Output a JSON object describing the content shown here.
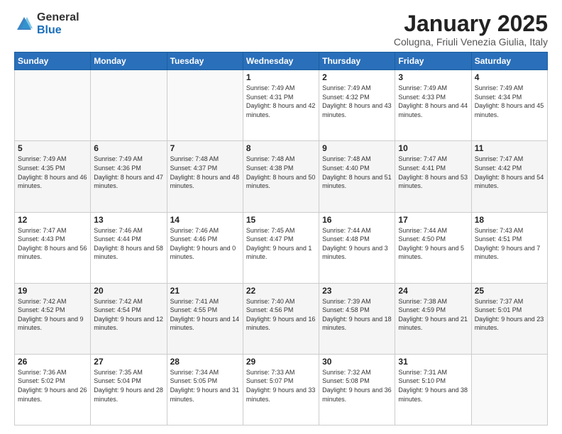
{
  "logo": {
    "general": "General",
    "blue": "Blue"
  },
  "title": {
    "month_year": "January 2025",
    "location": "Colugna, Friuli Venezia Giulia, Italy"
  },
  "weekdays": [
    "Sunday",
    "Monday",
    "Tuesday",
    "Wednesday",
    "Thursday",
    "Friday",
    "Saturday"
  ],
  "weeks": [
    [
      {
        "day": "",
        "info": ""
      },
      {
        "day": "",
        "info": ""
      },
      {
        "day": "",
        "info": ""
      },
      {
        "day": "1",
        "info": "Sunrise: 7:49 AM\nSunset: 4:31 PM\nDaylight: 8 hours and 42 minutes."
      },
      {
        "day": "2",
        "info": "Sunrise: 7:49 AM\nSunset: 4:32 PM\nDaylight: 8 hours and 43 minutes."
      },
      {
        "day": "3",
        "info": "Sunrise: 7:49 AM\nSunset: 4:33 PM\nDaylight: 8 hours and 44 minutes."
      },
      {
        "day": "4",
        "info": "Sunrise: 7:49 AM\nSunset: 4:34 PM\nDaylight: 8 hours and 45 minutes."
      }
    ],
    [
      {
        "day": "5",
        "info": "Sunrise: 7:49 AM\nSunset: 4:35 PM\nDaylight: 8 hours and 46 minutes."
      },
      {
        "day": "6",
        "info": "Sunrise: 7:49 AM\nSunset: 4:36 PM\nDaylight: 8 hours and 47 minutes."
      },
      {
        "day": "7",
        "info": "Sunrise: 7:48 AM\nSunset: 4:37 PM\nDaylight: 8 hours and 48 minutes."
      },
      {
        "day": "8",
        "info": "Sunrise: 7:48 AM\nSunset: 4:38 PM\nDaylight: 8 hours and 50 minutes."
      },
      {
        "day": "9",
        "info": "Sunrise: 7:48 AM\nSunset: 4:40 PM\nDaylight: 8 hours and 51 minutes."
      },
      {
        "day": "10",
        "info": "Sunrise: 7:47 AM\nSunset: 4:41 PM\nDaylight: 8 hours and 53 minutes."
      },
      {
        "day": "11",
        "info": "Sunrise: 7:47 AM\nSunset: 4:42 PM\nDaylight: 8 hours and 54 minutes."
      }
    ],
    [
      {
        "day": "12",
        "info": "Sunrise: 7:47 AM\nSunset: 4:43 PM\nDaylight: 8 hours and 56 minutes."
      },
      {
        "day": "13",
        "info": "Sunrise: 7:46 AM\nSunset: 4:44 PM\nDaylight: 8 hours and 58 minutes."
      },
      {
        "day": "14",
        "info": "Sunrise: 7:46 AM\nSunset: 4:46 PM\nDaylight: 9 hours and 0 minutes."
      },
      {
        "day": "15",
        "info": "Sunrise: 7:45 AM\nSunset: 4:47 PM\nDaylight: 9 hours and 1 minute."
      },
      {
        "day": "16",
        "info": "Sunrise: 7:44 AM\nSunset: 4:48 PM\nDaylight: 9 hours and 3 minutes."
      },
      {
        "day": "17",
        "info": "Sunrise: 7:44 AM\nSunset: 4:50 PM\nDaylight: 9 hours and 5 minutes."
      },
      {
        "day": "18",
        "info": "Sunrise: 7:43 AM\nSunset: 4:51 PM\nDaylight: 9 hours and 7 minutes."
      }
    ],
    [
      {
        "day": "19",
        "info": "Sunrise: 7:42 AM\nSunset: 4:52 PM\nDaylight: 9 hours and 9 minutes."
      },
      {
        "day": "20",
        "info": "Sunrise: 7:42 AM\nSunset: 4:54 PM\nDaylight: 9 hours and 12 minutes."
      },
      {
        "day": "21",
        "info": "Sunrise: 7:41 AM\nSunset: 4:55 PM\nDaylight: 9 hours and 14 minutes."
      },
      {
        "day": "22",
        "info": "Sunrise: 7:40 AM\nSunset: 4:56 PM\nDaylight: 9 hours and 16 minutes."
      },
      {
        "day": "23",
        "info": "Sunrise: 7:39 AM\nSunset: 4:58 PM\nDaylight: 9 hours and 18 minutes."
      },
      {
        "day": "24",
        "info": "Sunrise: 7:38 AM\nSunset: 4:59 PM\nDaylight: 9 hours and 21 minutes."
      },
      {
        "day": "25",
        "info": "Sunrise: 7:37 AM\nSunset: 5:01 PM\nDaylight: 9 hours and 23 minutes."
      }
    ],
    [
      {
        "day": "26",
        "info": "Sunrise: 7:36 AM\nSunset: 5:02 PM\nDaylight: 9 hours and 26 minutes."
      },
      {
        "day": "27",
        "info": "Sunrise: 7:35 AM\nSunset: 5:04 PM\nDaylight: 9 hours and 28 minutes."
      },
      {
        "day": "28",
        "info": "Sunrise: 7:34 AM\nSunset: 5:05 PM\nDaylight: 9 hours and 31 minutes."
      },
      {
        "day": "29",
        "info": "Sunrise: 7:33 AM\nSunset: 5:07 PM\nDaylight: 9 hours and 33 minutes."
      },
      {
        "day": "30",
        "info": "Sunrise: 7:32 AM\nSunset: 5:08 PM\nDaylight: 9 hours and 36 minutes."
      },
      {
        "day": "31",
        "info": "Sunrise: 7:31 AM\nSunset: 5:10 PM\nDaylight: 9 hours and 38 minutes."
      },
      {
        "day": "",
        "info": ""
      }
    ]
  ]
}
